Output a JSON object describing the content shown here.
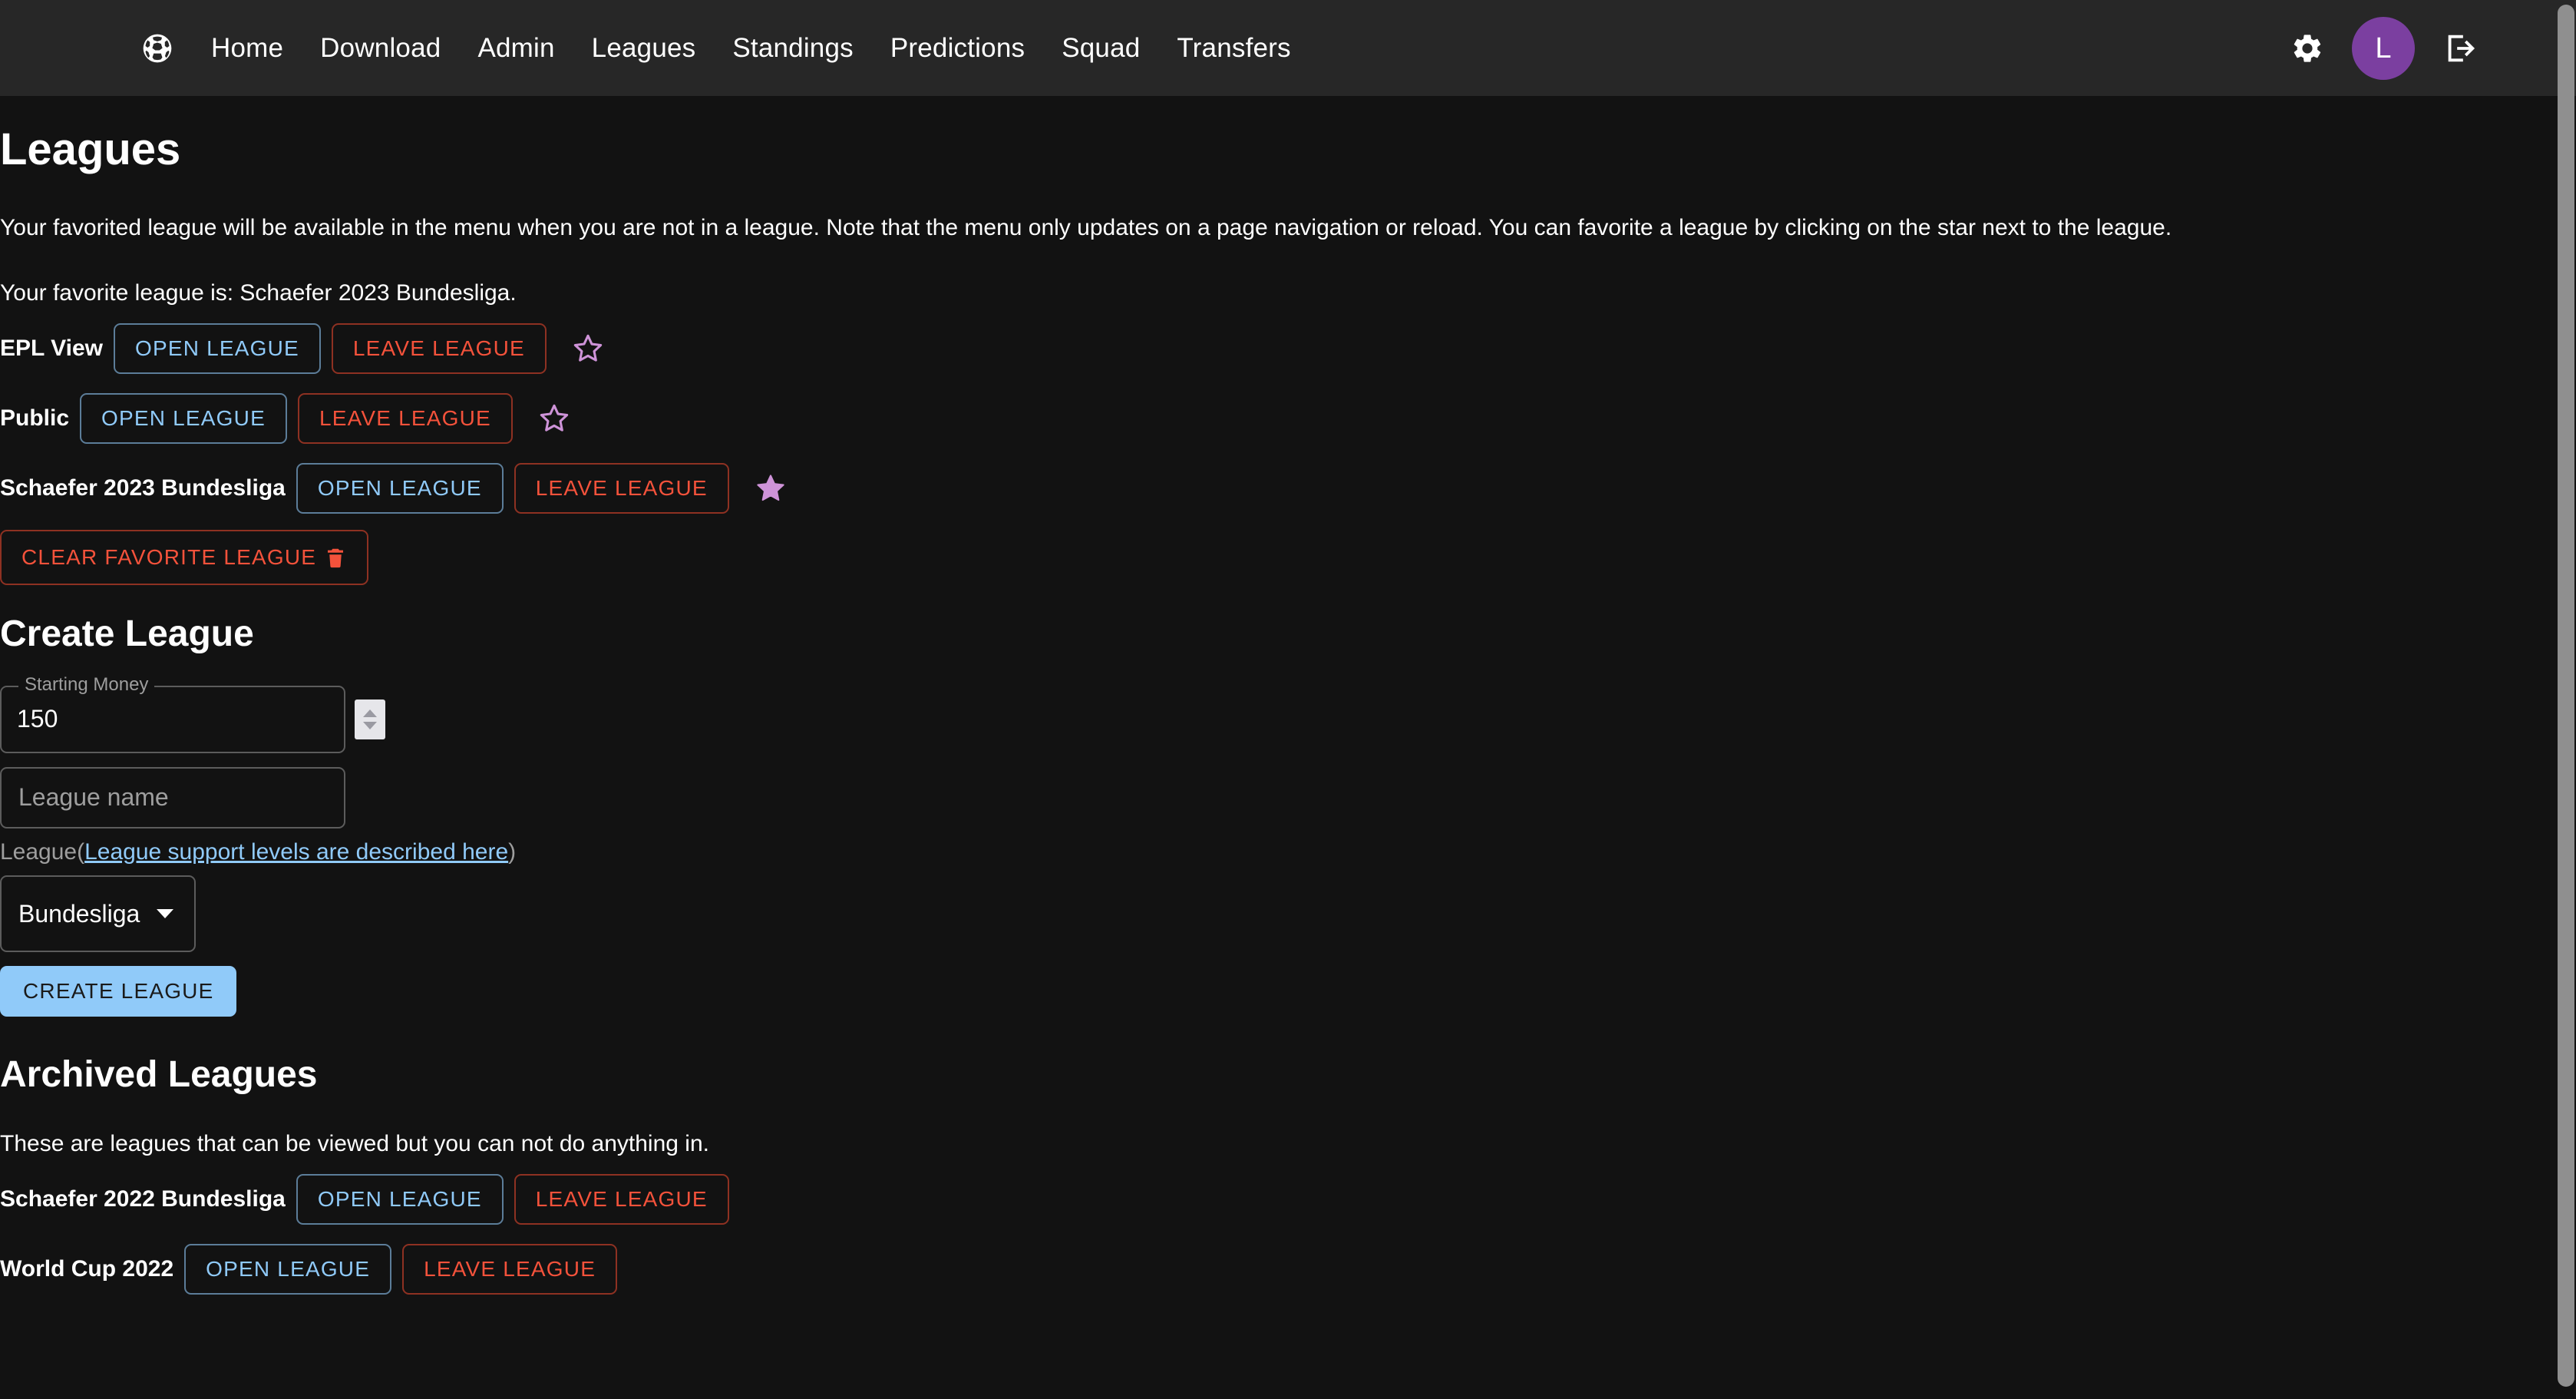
{
  "header": {
    "logo_icon": "soccer-ball-icon",
    "nav": [
      {
        "label": "Home"
      },
      {
        "label": "Download"
      },
      {
        "label": "Admin"
      },
      {
        "label": "Leagues"
      },
      {
        "label": "Standings"
      },
      {
        "label": "Predictions"
      },
      {
        "label": "Squad"
      },
      {
        "label": "Transfers"
      }
    ],
    "settings_icon": "gear-icon",
    "avatar_initial": "L",
    "logout_icon": "logout-icon",
    "background_color": "#272727",
    "avatar_color": "#7b3fa0"
  },
  "page": {
    "title": "Leagues",
    "intro": "Your favorited league will be available in the menu when you are not in a league. Note that the menu only updates on a page navigation or reload. You can favorite a league by clicking on the star next to the league.",
    "favorite_line": "Your favorite league is: Schaefer 2023 Bundesliga.",
    "background_color": "#121212"
  },
  "buttons": {
    "open_league": "OPEN LEAGUE",
    "leave_league": "LEAVE LEAGUE",
    "clear_favorite": "CLEAR FAVORITE LEAGUE",
    "create_league": "CREATE LEAGUE"
  },
  "colors": {
    "open_text": "#90caf9",
    "leave_text": "#f4523b",
    "star_filled": "#ce93d8",
    "star_outline": "#ce93d8",
    "link": "#90caf9",
    "create_bg": "#90caf9"
  },
  "leagues": [
    {
      "name": "EPL View",
      "favorited": false
    },
    {
      "name": "Public",
      "favorited": false
    },
    {
      "name": "Schaefer 2023 Bundesliga",
      "favorited": true
    }
  ],
  "create_league": {
    "heading": "Create League",
    "starting_money": {
      "label": "Starting Money",
      "value": "150",
      "spinner_icon": "number-stepper-icon"
    },
    "league_name": {
      "placeholder": "League name",
      "value": ""
    },
    "support_prefix": "League(",
    "support_link": "League support levels are described here",
    "support_suffix": ")",
    "league_select": {
      "value": "Bundesliga",
      "caret_icon": "chevron-down-icon"
    }
  },
  "archived": {
    "heading": "Archived Leagues",
    "description": "These are leagues that can be viewed but you can not do anything in.",
    "leagues": [
      {
        "name": "Schaefer 2022 Bundesliga"
      },
      {
        "name": "World Cup 2022"
      }
    ]
  }
}
